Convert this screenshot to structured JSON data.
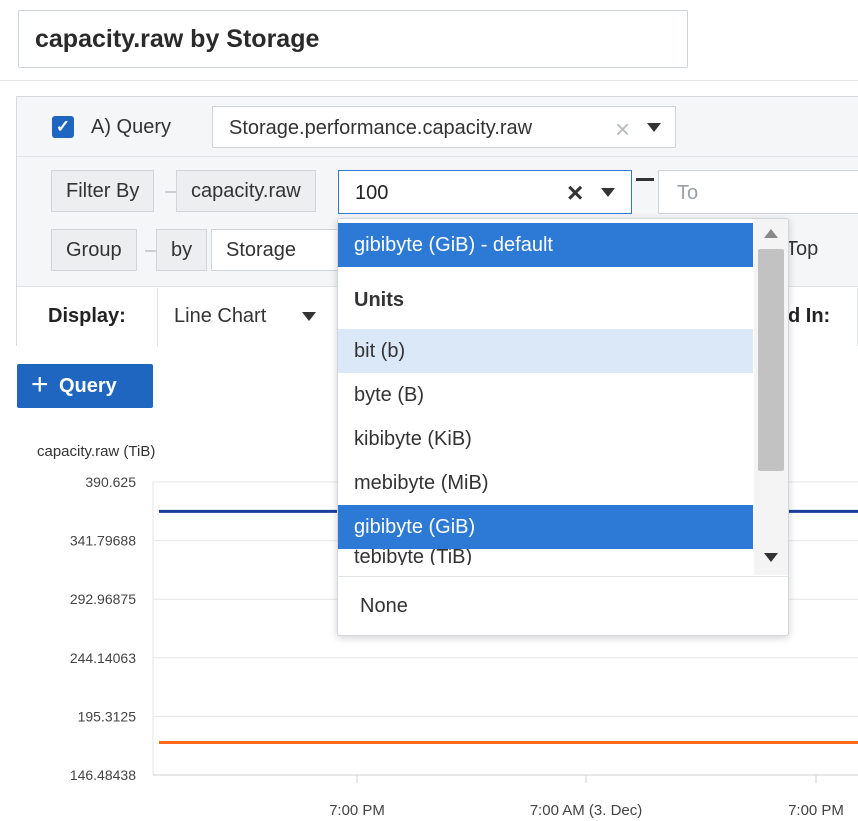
{
  "title": "capacity.raw by Storage",
  "query": {
    "checked": true,
    "label": "A) Query",
    "metric": "Storage.performance.capacity.raw",
    "clear_icon": "close-icon"
  },
  "filter": {
    "label": "Filter By",
    "field": "capacity.raw",
    "value": "100",
    "to_placeholder": "To"
  },
  "group": {
    "label": "Group",
    "by": "by",
    "field": "Storage",
    "top": "Top"
  },
  "display": {
    "label": "Display:",
    "chart_type": "Line Chart",
    "shown_in": "d In:"
  },
  "add_query": "Query",
  "unit_dropdown": {
    "selected": "gibibyte (GiB) - default",
    "header": "Units",
    "items": [
      "bit (b)",
      "byte (B)",
      "kibibyte (KiB)",
      "mebibyte (MiB)",
      "gibibyte (GiB)",
      "tebibyte (TiB)"
    ],
    "hover_index": 0,
    "selected_index": 4,
    "none": "None"
  },
  "chart_data": {
    "type": "line",
    "ylabel": "capacity.raw (TiB)",
    "y_ticks": [
      "390.625",
      "341.79688",
      "292.96875",
      "244.14063",
      "195.3125",
      "146.48438"
    ],
    "ylim": [
      146.48438,
      390.625
    ],
    "x_ticks": [
      "7:00 PM",
      "7:00 AM (3. Dec)",
      "7:00 PM"
    ],
    "series": [
      {
        "color": "#1b3fa0",
        "values": [
          366.2,
          366.2
        ]
      },
      {
        "color": "#ff6a1a",
        "values": [
          173.6,
          173.6
        ]
      }
    ],
    "grid": true
  }
}
